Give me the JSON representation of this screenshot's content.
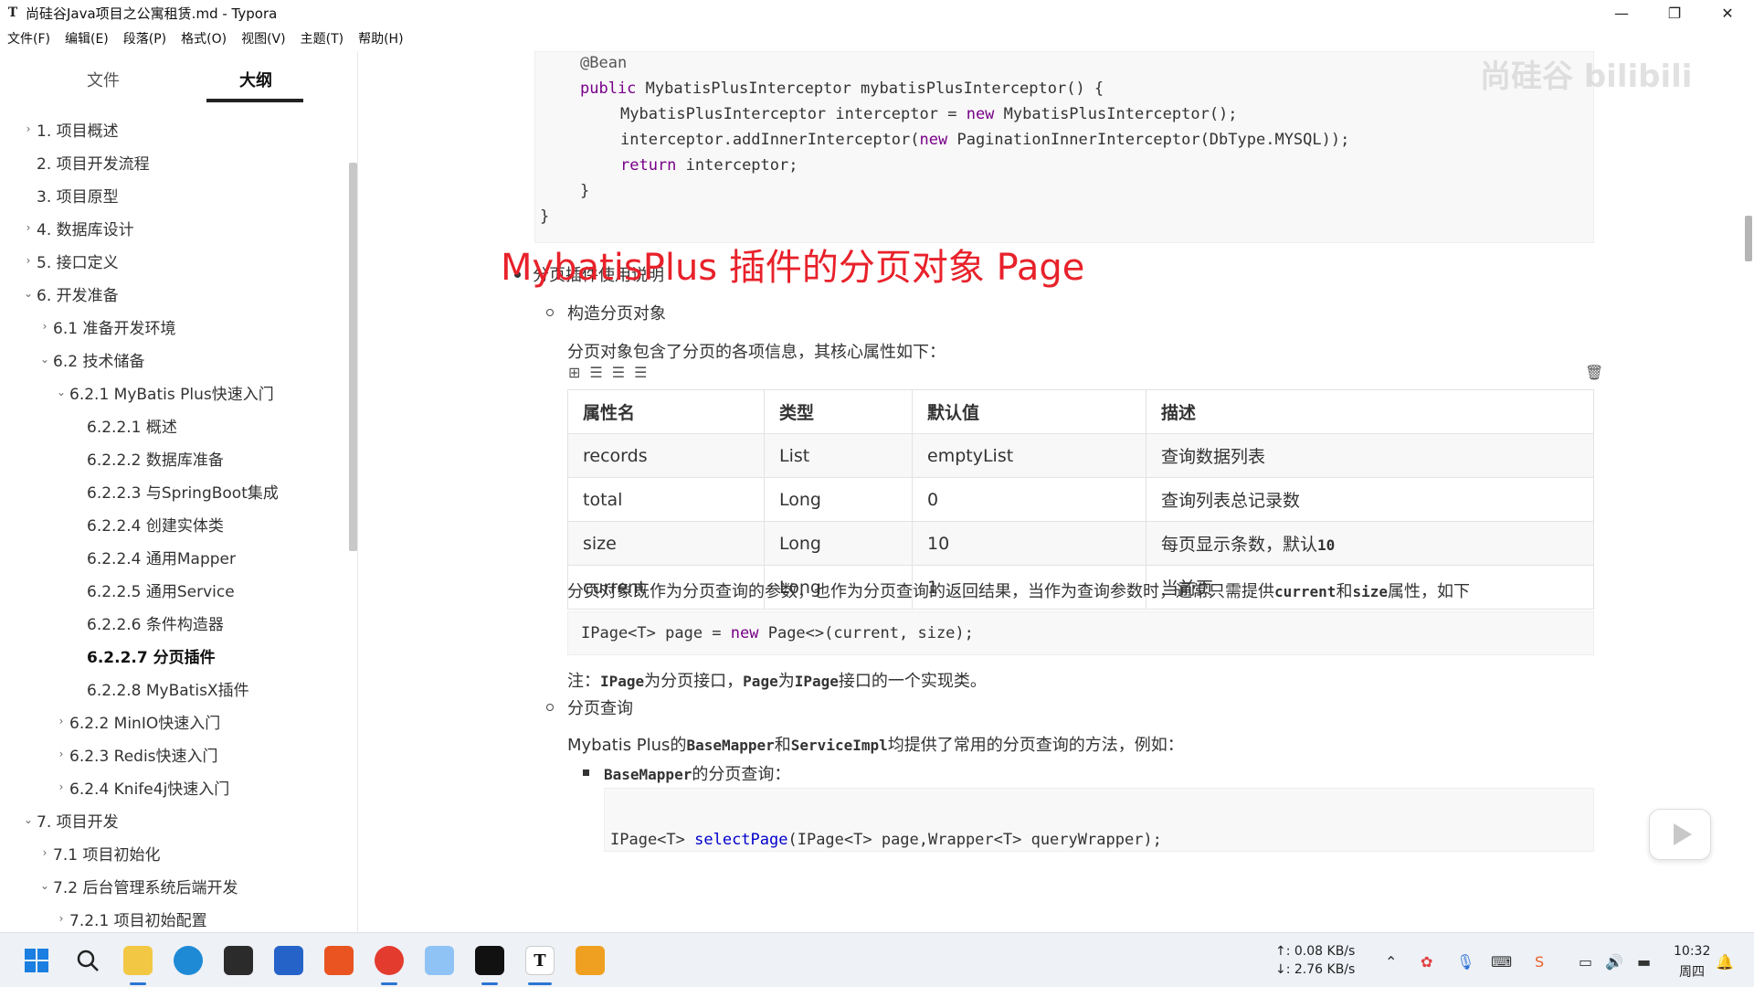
{
  "window": {
    "app_icon": "T",
    "title": "尚硅谷Java项目之公寓租赁.md - Typora",
    "minimize": "—",
    "maximize": "❐",
    "close": "✕"
  },
  "menu": [
    "文件(F)",
    "编辑(E)",
    "段落(P)",
    "格式(O)",
    "视图(V)",
    "主题(T)",
    "帮助(H)"
  ],
  "sidebar": {
    "tab_files": "文件",
    "tab_outline": "大纲",
    "items": [
      {
        "label": "1. 项目概述",
        "chev": "›"
      },
      {
        "label": "2. 项目开发流程",
        "chev": ""
      },
      {
        "label": "3. 项目原型",
        "chev": ""
      },
      {
        "label": "4. 数据库设计",
        "chev": "›"
      },
      {
        "label": "5. 接口定义",
        "chev": "›"
      },
      {
        "label": "6. 开发准备",
        "chev": "⌄"
      },
      {
        "label": "6.1 准备开发环境",
        "chev": "›"
      },
      {
        "label": "6.2 技术储备",
        "chev": "⌄"
      },
      {
        "label": "6.2.1 MyBatis Plus快速入门",
        "chev": "⌄"
      },
      {
        "label": "6.2.2.1 概述",
        "chev": ""
      },
      {
        "label": "6.2.2.2 数据库准备",
        "chev": ""
      },
      {
        "label": "6.2.2.3 与SpringBoot集成",
        "chev": ""
      },
      {
        "label": "6.2.2.4 创建实体类",
        "chev": ""
      },
      {
        "label": "6.2.2.4 通用Mapper",
        "chev": ""
      },
      {
        "label": "6.2.2.5 通用Service",
        "chev": ""
      },
      {
        "label": "6.2.2.6 条件构造器",
        "chev": ""
      },
      {
        "label": "6.2.2.7 分页插件",
        "chev": ""
      },
      {
        "label": "6.2.2.8 MyBatisX插件",
        "chev": ""
      },
      {
        "label": "6.2.2 MinIO快速入门",
        "chev": "›"
      },
      {
        "label": "6.2.3 Redis快速入门",
        "chev": "›"
      },
      {
        "label": "6.2.4 Knife4j快速入门",
        "chev": "›"
      },
      {
        "label": "7. 项目开发",
        "chev": "⌄"
      },
      {
        "label": "7.1 项目初始化",
        "chev": "›"
      },
      {
        "label": "7.2 后台管理系统后端开发",
        "chev": "⌄"
      },
      {
        "label": "7.2.1 项目初始配置",
        "chev": "›"
      }
    ]
  },
  "code_top": {
    "l1": "@Bean",
    "l2_kw": "public",
    "l2_rest": " MybatisPlusInterceptor mybatisPlusInterceptor() {",
    "l3_a": "MybatisPlusInterceptor interceptor = ",
    "l3_kw": "new",
    "l3_b": " MybatisPlusInterceptor();",
    "l4_a": "interceptor.addInnerInterceptor(",
    "l4_kw": "new",
    "l4_b": " PaginationInnerInterceptor(DbType.MYSQL));",
    "l5_kw": "return",
    "l5_rest": " interceptor;",
    "l6": "}",
    "l7": "}"
  },
  "content": {
    "bullet_plugin": "分页插件使用说明",
    "bullet_construct": "构造分页对象",
    "overlay": "MybatisPlus 插件的分页对象 Page",
    "desc": "分页对象包含了分页的各项信息，其核心属性如下：",
    "table_tools": [
      "⊞",
      "☰",
      "☰",
      "☰"
    ],
    "table_trash": "🗑",
    "table": {
      "headers": [
        "属性名",
        "类型",
        "默认值",
        "描述"
      ],
      "rows": [
        [
          "records",
          "List",
          "emptyList",
          "查询数据列表"
        ],
        [
          "total",
          "Long",
          "0",
          "查询列表总记录数"
        ],
        [
          "size",
          "Long",
          "10",
          "每页显示条数，默认"
        ],
        [
          "current",
          "Long",
          "1",
          "当前页"
        ]
      ],
      "size_default_code": "10"
    },
    "para_usage_a": "分页对象既作为分页查询的参数，也作为分页查询的返回结果，当作为查询参数时，通常只需提供",
    "para_usage_c1": "current",
    "para_usage_mid": "和",
    "para_usage_c2": "size",
    "para_usage_b": "属性，如下",
    "code_page": {
      "a": "IPage<T> page = ",
      "kw": "new",
      "b": " Page<>(current, size);"
    },
    "note_a": "注：",
    "note_c1": "IPage",
    "note_mid1": "为分页接口，",
    "note_c2": "Page",
    "note_mid2": "为",
    "note_c3": "IPage",
    "note_b": "接口的一个实现类。",
    "bullet_query": "分页查询",
    "para_mp_a": "Mybatis Plus的",
    "para_mp_c1": "BaseMapper",
    "para_mp_mid": "和",
    "para_mp_c2": "ServiceImpl",
    "para_mp_b": "均提供了常用的分页查询的方法，例如：",
    "bullet_basemapper_code": "BaseMapper",
    "bullet_basemapper_text": "的分页查询：",
    "code_bottom": {
      "a": "IPage<T> ",
      "fn": "selectPage",
      "b": "(IPage<T> page,Wrapper<T> queryWrapper);"
    }
  },
  "watermark": "尚硅谷 bilibili",
  "taskbar": {
    "upload": "↑: 0.08 KB/s",
    "download": "↓: 2.76 KB/s",
    "time": "10:32",
    "day": "周四"
  }
}
